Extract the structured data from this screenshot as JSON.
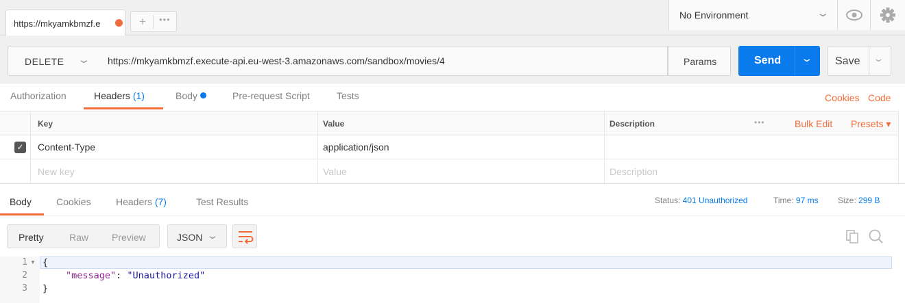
{
  "tabs": {
    "request_tab_label": "https://mkyamkbmzf.e",
    "plus": "+",
    "more": "•••"
  },
  "environment": {
    "label": "No Environment"
  },
  "request": {
    "method": "DELETE",
    "url": "https://mkyamkbmzf.execute-api.eu-west-3.amazonaws.com/sandbox/movies/4",
    "params_label": "Params",
    "send_label": "Send",
    "save_label": "Save"
  },
  "request_tabs": {
    "authorization": "Authorization",
    "headers": "Headers",
    "headers_count": "(1)",
    "body": "Body",
    "pre_request": "Pre-request Script",
    "tests": "Tests",
    "cookies": "Cookies",
    "code": "Code"
  },
  "headers_table": {
    "columns": {
      "key": "Key",
      "value": "Value",
      "description": "Description"
    },
    "bulk_edit": "Bulk Edit",
    "presets": "Presets ▾",
    "more": "•••",
    "rows": [
      {
        "key": "Content-Type",
        "value": "application/json",
        "description": "",
        "enabled": true
      }
    ],
    "placeholders": {
      "key": "New key",
      "value": "Value",
      "description": "Description"
    }
  },
  "response_tabs": {
    "body": "Body",
    "cookies": "Cookies",
    "headers": "Headers",
    "headers_count": "(7)",
    "test_results": "Test Results"
  },
  "response_status": {
    "status_label": "Status:",
    "status_value": "401 Unauthorized",
    "time_label": "Time:",
    "time_value": "97 ms",
    "size_label": "Size:",
    "size_value": "299 B"
  },
  "view": {
    "pretty": "Pretty",
    "raw": "Raw",
    "preview": "Preview",
    "format": "JSON"
  },
  "editor": {
    "line_numbers": [
      "1",
      "2",
      "3"
    ],
    "open_brace": "{",
    "key": "\"message\"",
    "colon": ": ",
    "value": "\"Unauthorized\"",
    "close_brace": "}"
  },
  "colors": {
    "accent_orange": "#f26b3a",
    "accent_blue": "#097bed"
  }
}
